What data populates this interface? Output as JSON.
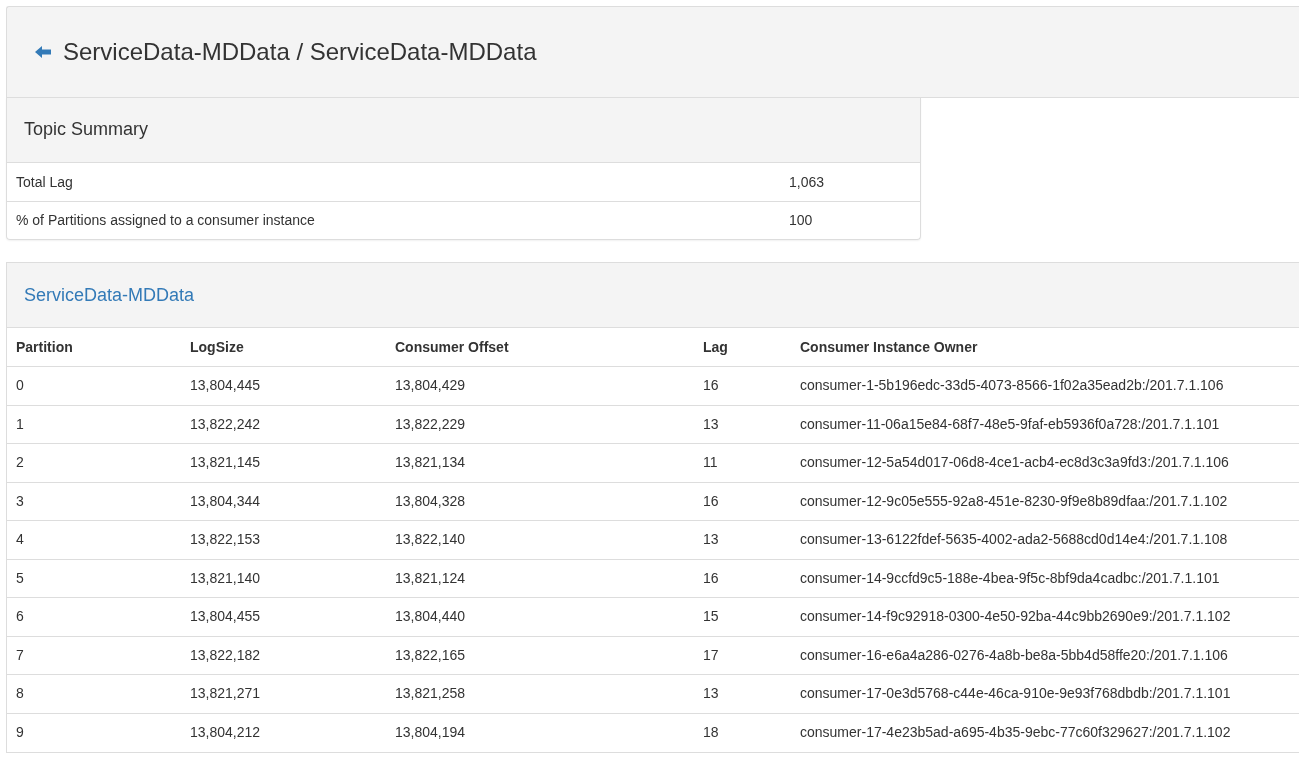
{
  "page_header": {
    "title": "ServiceData-MDData / ServiceData-MDData"
  },
  "topic_summary": {
    "title": "Topic Summary",
    "rows": [
      {
        "label": "Total Lag",
        "value": "1,063"
      },
      {
        "label": "% of Partitions assigned to a consumer instance",
        "value": "100"
      }
    ]
  },
  "partitions_panel": {
    "title": "ServiceData-MDData",
    "columns": [
      "Partition",
      "LogSize",
      "Consumer Offset",
      "Lag",
      "Consumer Instance Owner"
    ],
    "rows": [
      [
        "0",
        "13,804,445",
        "13,804,429",
        "16",
        "consumer-1-5b196edc-33d5-4073-8566-1f02a35ead2b:/201.7.1.106"
      ],
      [
        "1",
        "13,822,242",
        "13,822,229",
        "13",
        "consumer-11-06a15e84-68f7-48e5-9faf-eb5936f0a728:/201.7.1.101"
      ],
      [
        "2",
        "13,821,145",
        "13,821,134",
        "11",
        "consumer-12-5a54d017-06d8-4ce1-acb4-ec8d3c3a9fd3:/201.7.1.106"
      ],
      [
        "3",
        "13,804,344",
        "13,804,328",
        "16",
        "consumer-12-9c05e555-92a8-451e-8230-9f9e8b89dfaa:/201.7.1.102"
      ],
      [
        "4",
        "13,822,153",
        "13,822,140",
        "13",
        "consumer-13-6122fdef-5635-4002-ada2-5688cd0d14e4:/201.7.1.108"
      ],
      [
        "5",
        "13,821,140",
        "13,821,124",
        "16",
        "consumer-14-9ccfd9c5-188e-4bea-9f5c-8bf9da4cadbc:/201.7.1.101"
      ],
      [
        "6",
        "13,804,455",
        "13,804,440",
        "15",
        "consumer-14-f9c92918-0300-4e50-92ba-44c9bb2690e9:/201.7.1.102"
      ],
      [
        "7",
        "13,822,182",
        "13,822,165",
        "17",
        "consumer-16-e6a4a286-0276-4a8b-be8a-5bb4d58ffe20:/201.7.1.106"
      ],
      [
        "8",
        "13,821,271",
        "13,821,258",
        "13",
        "consumer-17-0e3d5768-c44e-46ca-910e-9e93f768dbdb:/201.7.1.101"
      ],
      [
        "9",
        "13,804,212",
        "13,804,194",
        "18",
        "consumer-17-4e23b5ad-a695-4b35-9ebc-77c60f329627:/201.7.1.102"
      ]
    ]
  }
}
